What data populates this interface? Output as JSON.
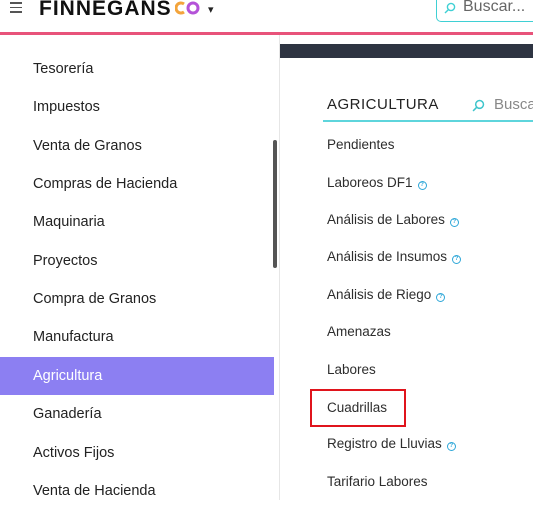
{
  "header": {
    "brand": "FINNEGANS",
    "brand_caret": "▾",
    "search_placeholder": "Buscar..."
  },
  "sidebar": {
    "items": [
      {
        "label": "Tesorería"
      },
      {
        "label": "Impuestos"
      },
      {
        "label": "Venta de Granos"
      },
      {
        "label": "Compras de Hacienda"
      },
      {
        "label": "Maquinaria"
      },
      {
        "label": "Proyectos"
      },
      {
        "label": "Compra de Granos"
      },
      {
        "label": "Manufactura"
      },
      {
        "label": "Agricultura",
        "active": true
      },
      {
        "label": "Ganadería"
      },
      {
        "label": "Activos Fijos"
      },
      {
        "label": "Venta de Hacienda"
      }
    ]
  },
  "panel": {
    "title": "AGRICULTURA",
    "search_label": "Busca",
    "items": [
      {
        "label": "Pendientes",
        "info": false
      },
      {
        "label": "Laboreos DF1",
        "info": true
      },
      {
        "label": "Análisis de Labores",
        "info": true
      },
      {
        "label": "Análisis de Insumos",
        "info": true
      },
      {
        "label": "Análisis de Riego",
        "info": true
      },
      {
        "label": "Amenazas",
        "info": false
      },
      {
        "label": "Labores",
        "info": false
      },
      {
        "label": "Cuadrillas",
        "info": false,
        "highlighted": true
      },
      {
        "label": "Registro de Lluvias",
        "info": true
      },
      {
        "label": "Tarifario Labores",
        "info": false
      }
    ],
    "info_glyph": "?"
  },
  "colors": {
    "accent_pink": "#e8537a",
    "active_purple": "#8c7ff2",
    "teal": "#5ed5dc",
    "highlight_red": "#e0141c"
  }
}
